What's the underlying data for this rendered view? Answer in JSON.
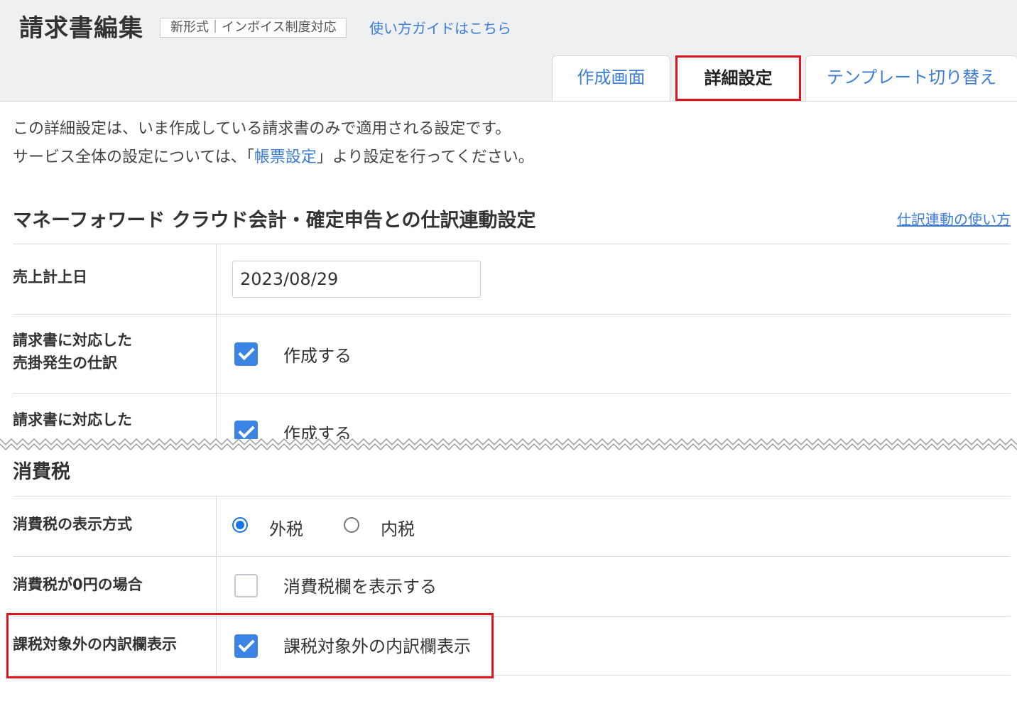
{
  "header": {
    "title": "請求書編集",
    "format_badge": "新形式｜インボイス制度対応",
    "guide_link": "使い方ガイドはこちら"
  },
  "tabs": [
    {
      "label": "作成画面",
      "active": false
    },
    {
      "label": "詳細設定",
      "active": true
    },
    {
      "label": "テンプレート切り替え",
      "active": false
    }
  ],
  "intro": {
    "line1": "この詳細設定は、いま作成している請求書のみで適用される設定です。",
    "line2_before": "サービス全体の設定については、「",
    "line2_link": "帳票設定",
    "line2_after": "」より設定を行ってください。"
  },
  "journal_section": {
    "title": "マネーフォワード クラウド会計・確定申告との仕訳連動設定",
    "help_link": "仕訳連動の使い方",
    "rows": [
      {
        "label": "売上計上日",
        "value": "2023/08/29"
      },
      {
        "label_line1": "請求書に対応した",
        "label_line2": "売掛発生の仕訳",
        "checkbox_label": "作成する",
        "checked": true
      },
      {
        "label_line1": "請求書に対応した",
        "checkbox_label": "作成する",
        "checked": true
      }
    ]
  },
  "tax_section": {
    "title": "消費税",
    "rows": [
      {
        "label": "消費税の表示方式",
        "options": [
          {
            "label": "外税",
            "selected": true
          },
          {
            "label": "内税",
            "selected": false
          }
        ]
      },
      {
        "label": "消費税が0円の場合",
        "checkbox_label": "消費税欄を表示する",
        "checked": false
      },
      {
        "label": "課税対象外の内訳欄表示",
        "checkbox_label": "課税対象外の内訳欄表示",
        "checked": true
      }
    ]
  },
  "colors": {
    "accent": "#3b7dd8",
    "checkbox": "#3b84e3",
    "highlight": "#e0141e",
    "header_bg": "#eff0f2"
  }
}
